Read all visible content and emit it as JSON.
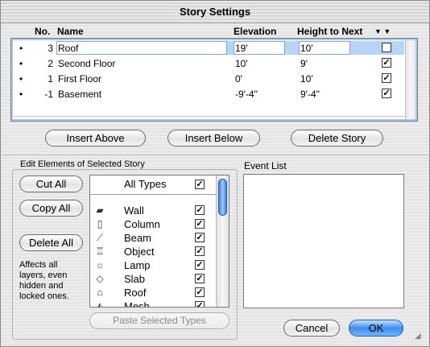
{
  "window": {
    "title": "Story Settings"
  },
  "columns": {
    "no": "No.",
    "name": "Name",
    "elevation": "Elevation",
    "height": "Height to Next"
  },
  "stories": [
    {
      "bullet": "•",
      "no": "3",
      "name": "Roof",
      "elevation": "19'",
      "height": "10'",
      "checked": false
    },
    {
      "bullet": "•",
      "no": "2",
      "name": "Second Floor",
      "elevation": "10'",
      "height": "9'",
      "checked": true
    },
    {
      "bullet": "•",
      "no": "1",
      "name": "First Floor",
      "elevation": "0'",
      "height": "10'",
      "checked": true
    },
    {
      "bullet": "•",
      "no": "-1",
      "name": "Basement",
      "elevation": "-9'-4\"",
      "height": "9'-4\"",
      "checked": true
    }
  ],
  "story_buttons": {
    "insert_above": "Insert Above",
    "insert_below": "Insert Below",
    "delete_story": "Delete Story"
  },
  "edit_elements": {
    "label": "Edit Elements of Selected Story",
    "cut_all": "Cut All",
    "copy_all": "Copy All",
    "delete_all": "Delete All",
    "note": "Affects all layers, even hidden and locked ones.",
    "paste": "Paste Selected Types"
  },
  "types": {
    "header": "All Types",
    "items": [
      {
        "label": "Wall",
        "icon": "wall-icon",
        "checked": true
      },
      {
        "label": "Column",
        "icon": "column-icon",
        "checked": true
      },
      {
        "label": "Beam",
        "icon": "beam-icon",
        "checked": true
      },
      {
        "label": "Object",
        "icon": "object-icon",
        "checked": true
      },
      {
        "label": "Lamp",
        "icon": "lamp-icon",
        "checked": true
      },
      {
        "label": "Slab",
        "icon": "slab-icon",
        "checked": true
      },
      {
        "label": "Roof",
        "icon": "roof-icon",
        "checked": true
      },
      {
        "label": "Mesh",
        "icon": "mesh-icon",
        "checked": true
      }
    ]
  },
  "event_list": {
    "label": "Event List"
  },
  "footer": {
    "cancel": "Cancel",
    "ok": "OK"
  },
  "colors": {
    "default_button": "#3f8ef0",
    "selection": "#b8d4f6"
  }
}
